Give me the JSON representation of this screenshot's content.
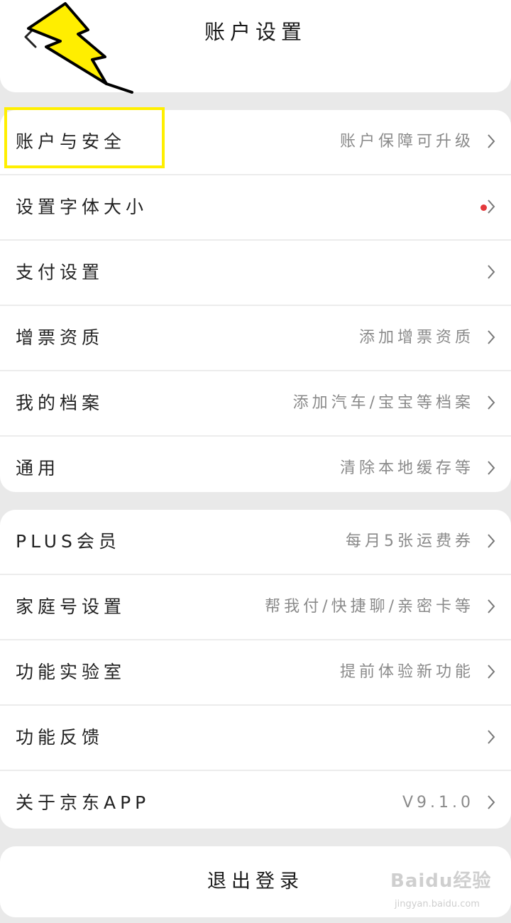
{
  "header": {
    "title": "账户设置"
  },
  "group1": [
    {
      "label": "账户与安全",
      "value": "账户保障可升级"
    },
    {
      "label": "设置字体大小",
      "value": ""
    },
    {
      "label": "支付设置",
      "value": ""
    },
    {
      "label": "增票资质",
      "value": "添加增票资质"
    },
    {
      "label": "我的档案",
      "value": "添加汽车/宝宝等档案"
    },
    {
      "label": "通用",
      "value": "清除本地缓存等"
    }
  ],
  "group2": [
    {
      "label": "PLUS会员",
      "value": "每月5张运费券"
    },
    {
      "label": "家庭号设置",
      "value": "帮我付/快捷聊/亲密卡等"
    },
    {
      "label": "功能实验室",
      "value": "提前体验新功能"
    },
    {
      "label": "功能反馈",
      "value": ""
    },
    {
      "label": "关于京东APP",
      "value": "V9.1.0"
    }
  ],
  "logout_label": "退出登录",
  "watermark": {
    "brand": "Baidu经验",
    "url": "jingyan.baidu.com"
  },
  "colors": {
    "highlight": "#ffef00",
    "bolt": "#ffee00",
    "red_dot": "#e4393c"
  },
  "icons": {
    "back": "back-arrow-icon",
    "chevron": "chevron-right-icon",
    "annotation": "lightning-bolt-icon"
  }
}
